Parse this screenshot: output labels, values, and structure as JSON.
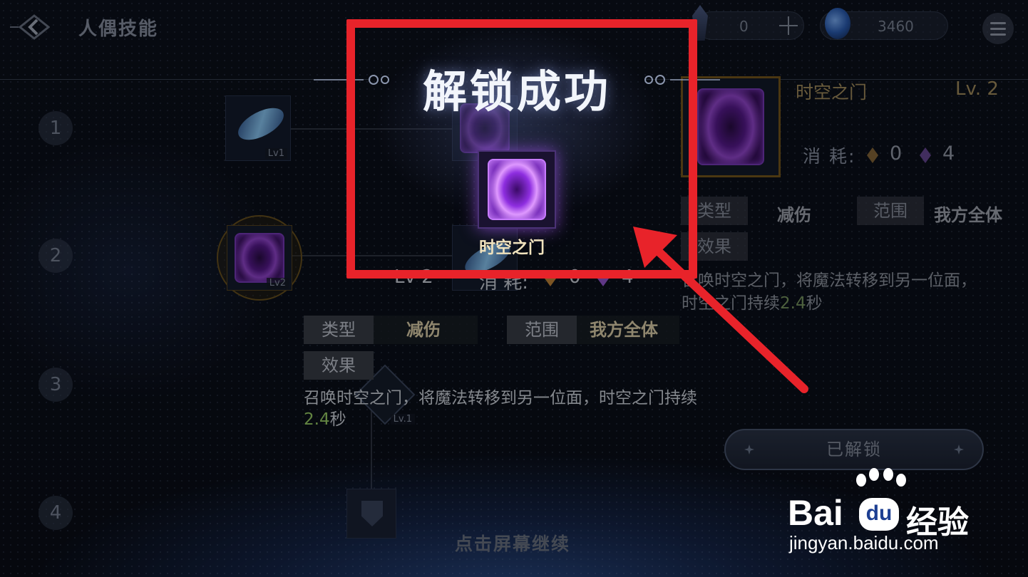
{
  "header": {
    "title": "人偶技能",
    "currency_1": "0",
    "currency_2": "3460"
  },
  "skill_tree": {
    "row_numbers": [
      "1",
      "2",
      "3",
      "4"
    ],
    "tile_levels": [
      "Lv1",
      "Lv2",
      "Lv.1"
    ]
  },
  "popup": {
    "title": "解锁成功",
    "skill_name": "时空之门"
  },
  "detail": {
    "level": "Lv 2",
    "cost_label": "消 耗:",
    "cost_a": "0",
    "cost_b": "4",
    "type_label": "类型",
    "type_value": "减伤",
    "range_label": "范围",
    "range_value": "我方全体",
    "effect_label": "效果",
    "description_main": "召唤时空之门，将魔法转移到另一位面，时空之门持续",
    "description_value": "2.4",
    "description_unit": "秒"
  },
  "right_panel": {
    "name": "时空之门",
    "level": "Lv. 2",
    "cost_label": "消 耗:",
    "cost_a": "0",
    "cost_b": "4",
    "type_label": "类型",
    "type_value": "减伤",
    "range_label": "范围",
    "range_value": "我方全体",
    "effect_label": "效果",
    "desc_line1": "召唤时空之门，将魔法转移到另一位面，",
    "desc_line2_prefix": "时空之门持续",
    "desc_value": "2.4",
    "desc_unit": "秒",
    "unlock_button": "已解锁"
  },
  "footer": {
    "continue_hint": "点击屏幕继续"
  },
  "watermark": {
    "brand_left": "Bai",
    "brand_mid": "du",
    "brand_right": "经验",
    "url": "jingyan.baidu.com"
  },
  "colors": {
    "annotation_red": "#e8232a",
    "portal_purple": "#9a4ad8",
    "accent_green": "#9ed66a",
    "gold": "#a89160"
  },
  "icons": [
    "back-arrow-icon",
    "gem-icon",
    "crystal-icon",
    "plus-icon",
    "menu-icon",
    "portal-icon",
    "feather-icon",
    "dagger-icon",
    "shield-icon",
    "baidu-paw-icon"
  ]
}
